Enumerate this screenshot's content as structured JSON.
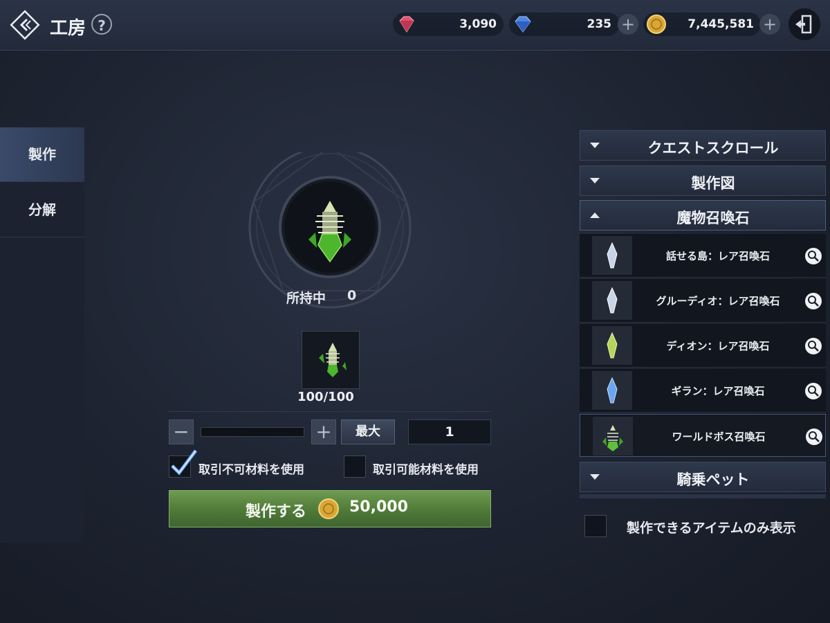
{
  "header": {
    "title": "工房",
    "help": "?",
    "currencies": [
      {
        "icon": "red-gem-icon",
        "amount": "3,090"
      },
      {
        "icon": "blue-gem-icon",
        "amount": "235"
      },
      {
        "icon": "gold-coin-icon",
        "amount": "7,445,581"
      }
    ]
  },
  "sidebar": {
    "tabs": [
      {
        "label": "製作",
        "active": true
      },
      {
        "label": "分解",
        "active": false
      }
    ]
  },
  "craft": {
    "held_label": "所持中",
    "held_value": "0",
    "material_count": "100/100",
    "quantity": "1",
    "slider_fraction": 0,
    "max_label": "最大",
    "use_untradeable_label": "取引不可材料を使用",
    "use_untradeable_checked": true,
    "use_tradeable_label": "取引可能材料を使用",
    "use_tradeable_checked": false,
    "button_label": "製作する",
    "cost": "50,000"
  },
  "list": {
    "categories": [
      {
        "label": "クエストスクロール",
        "open": false
      },
      {
        "label": "製作図",
        "open": false
      },
      {
        "label": "魔物召喚石",
        "open": true
      },
      {
        "label": "騎乗ペット",
        "open": false
      }
    ],
    "items": [
      {
        "name": "話せる島：レア召喚石",
        "color": "#c8d4e6"
      },
      {
        "name": "グルーディオ：レア召喚石",
        "color": "#c8d4e6"
      },
      {
        "name": "ディオン：レア召喚石",
        "color": "#b6d45a"
      },
      {
        "name": "ギラン：レア召喚石",
        "color": "#6aa6ee"
      },
      {
        "name": "ワールドボス召喚石",
        "color": "#5fbf3a",
        "selected": true
      }
    ],
    "filter_label": "製作できるアイテムのみ表示"
  }
}
